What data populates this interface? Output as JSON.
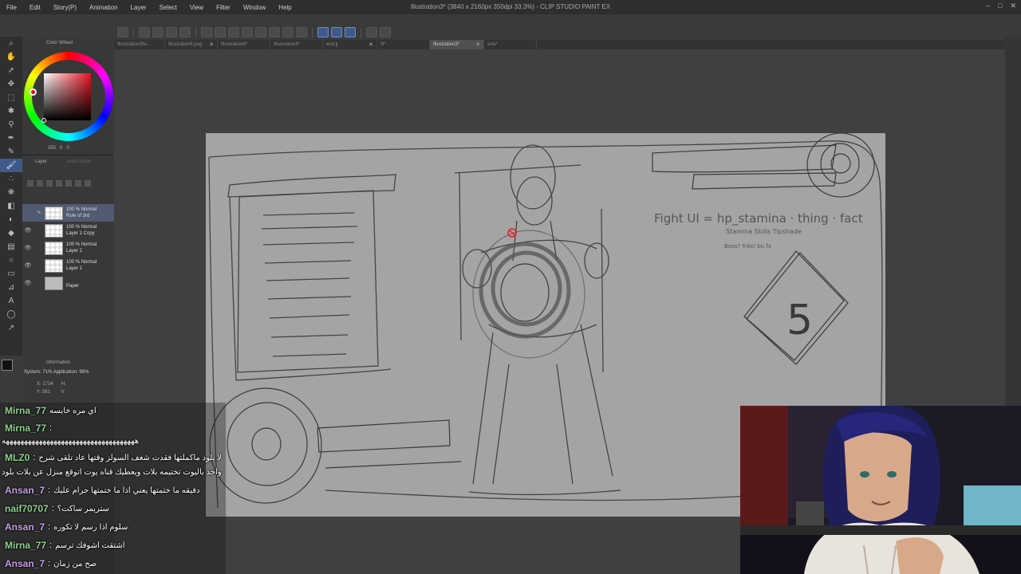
{
  "window": {
    "title": "Illustration3* (3840 x 2160px 350dpi 33.3%) - CLIP STUDIO PAINT EX",
    "controls": [
      "–",
      "□",
      "✕"
    ]
  },
  "menu": [
    "File",
    "Edit",
    "Story(P)",
    "Animation",
    "Layer",
    "Select",
    "View",
    "Filter",
    "Window",
    "Help"
  ],
  "tabs": [
    {
      "label": "Illustration(Re...",
      "active": false
    },
    {
      "label": "Illustration6.png",
      "active": false
    },
    {
      "label": "Illustration6*",
      "active": false
    },
    {
      "label": "Illustration4*",
      "active": false
    },
    {
      "label": "end.jj",
      "active": false
    },
    {
      "label": "ill*",
      "active": false
    },
    {
      "label": "Illustration3*",
      "active": true
    },
    {
      "label": "arta*",
      "active": false
    }
  ],
  "color_wheel": {
    "title": "Color Wheel",
    "h": "355",
    "s": "0",
    "v": "0",
    "main_color": "#111111",
    "sub_color": "#ffffff"
  },
  "layer_panel": {
    "title": "Layer",
    "title2": "Auto Action",
    "blend": "Normal",
    "layers": [
      {
        "opacity": "100 %",
        "blend": "Normal",
        "name": "Rule of 3rd",
        "visible": false,
        "active": true
      },
      {
        "opacity": "100 %",
        "blend": "Normal",
        "name": "Layer 1 Copy",
        "visible": true,
        "active": false
      },
      {
        "opacity": "100 %",
        "blend": "Normal",
        "name": "Layer 2",
        "visible": true,
        "active": false
      },
      {
        "opacity": "100 %",
        "blend": "Normal",
        "name": "Layer 1",
        "visible": true,
        "active": false
      },
      {
        "opacity": "",
        "blend": "",
        "name": "Paper",
        "visible": true,
        "active": false
      }
    ]
  },
  "info_panel": {
    "title": "Information",
    "system": "System: 71%",
    "application": "Application: 96%",
    "x": "X: 1734",
    "y": "Y: 561",
    "h": "H:",
    "v": "V:"
  },
  "canvas_sketch": {
    "formula_line1": "Fight UI = hp_stamina · thing · fact",
    "formula_line2": "Stamina  Skills  Tipshade",
    "formula_line3": "Boss?  f(de)  bu fx",
    "counter": "5"
  },
  "chat": [
    {
      "user": "Mirna_77",
      "text": "اي مره خايسه",
      "color": "#8fd18f"
    },
    {
      "user": "Mirna_77",
      "text": "",
      "color": "#8fd18f"
    },
    {
      "user": "",
      "text": "ههههههههههههههههههههههههههههههههههههه",
      "color": "#ffffff"
    },
    {
      "user": "MLZ0",
      "text": "لا بلود ماكملتها فقدت شغف السولز وقتها عاد تلقى شرح",
      "color": "#8fd18f"
    },
    {
      "user": "",
      "text": "واحد باليوت تختيمه بلات ويعطيك قناه يوت اتوقع منزل عن بلات بلود",
      "color": "#ffffff"
    },
    {
      "user": "Ansan_7",
      "text": "دقيقه ما ختمتها يعني اذا ما ختمتها حرام عليك",
      "color": "#c8a0e8"
    },
    {
      "user": "naif70707",
      "text": "ستريمر ساكت؟",
      "color": "#8fd18f"
    },
    {
      "user": "Ansan_7",
      "text": "سلوم اذا رسم لا تكوره",
      "color": "#c8a0e8"
    },
    {
      "user": "Mirna_77",
      "text": "اشتقت اشوفك ترسم",
      "color": "#8fd18f"
    },
    {
      "user": "Ansan_7",
      "text": "صح من زمان",
      "color": "#c8a0e8"
    }
  ]
}
